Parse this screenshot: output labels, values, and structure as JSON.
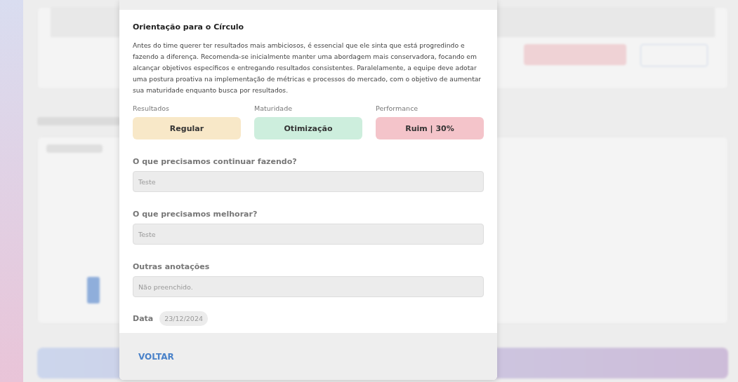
{
  "modal": {
    "title": "Orientação para o Círculo",
    "description": "Antes do time querer ter resultados mais ambiciosos, é essencial que ele sinta que está progredindo e fazendo a diferença. Recomenda-se inicialmente manter uma abordagem mais conservadora, focando em alcançar objetivos específicos e entregando resultados consistentes. Paralelamente, a equipe deve adotar uma postura proativa na implementação de métricas e processos do mercado, com o objetivo de aumentar sua maturidade enquanto busca por resultados.",
    "ratings": [
      {
        "label": "Resultados",
        "value": "Regular",
        "color": "#f8e8c8"
      },
      {
        "label": "Maturidade",
        "value": "Otimização",
        "color": "#cdeedd"
      },
      {
        "label": "Performance",
        "value": "Ruim | 30%",
        "color": "#f4c4ca"
      }
    ],
    "fields": [
      {
        "label": "O que precisamos continuar fazendo?",
        "value": "Teste"
      },
      {
        "label": "O que precisamos melhorar?",
        "value": "Teste"
      },
      {
        "label": "Outras anotações",
        "value": "Não preenchido."
      }
    ],
    "date": {
      "label": "Data",
      "value": "23/12/2024"
    },
    "back_button": "VOLTAR"
  }
}
